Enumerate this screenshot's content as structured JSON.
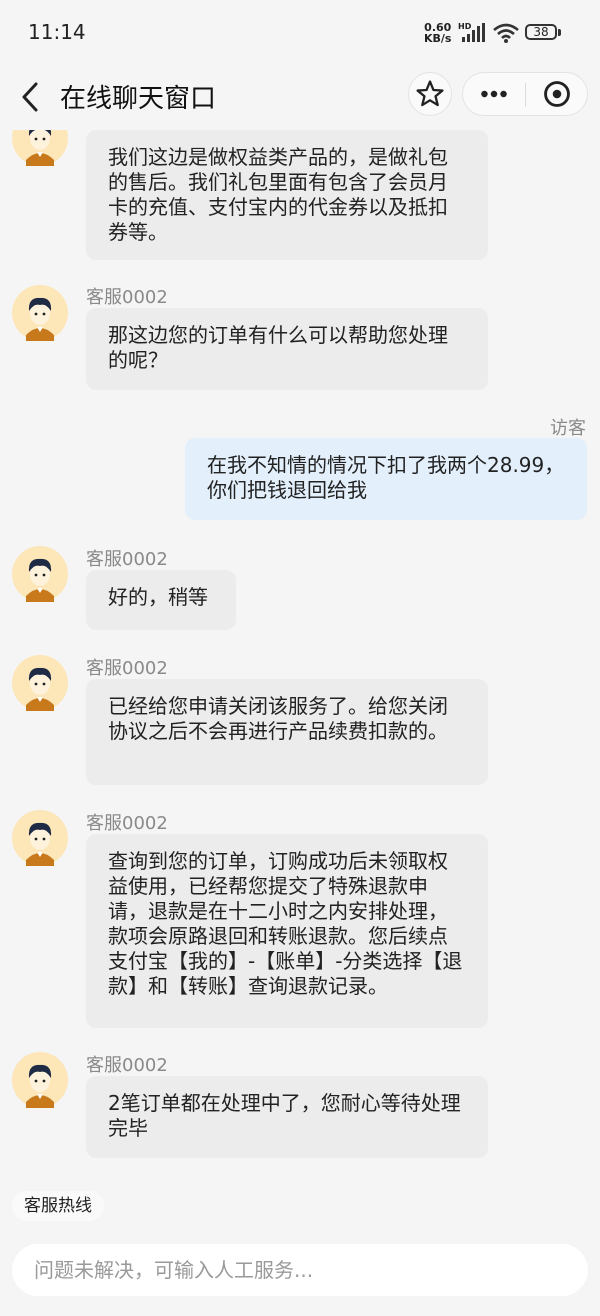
{
  "status_bar": {
    "time": "11:14",
    "net_speed": "0.60",
    "net_unit": "KB/s",
    "hd_label": "HD",
    "battery": "38"
  },
  "nav": {
    "title": "在线聊天窗口",
    "icons": [
      "chevron-left-icon",
      "star-icon",
      "more-icon",
      "target-icon"
    ]
  },
  "messages": [
    {
      "sender": "",
      "role": "agent",
      "text": "我们这边是做权益类产品的，是做礼包的售后。我们礼包里面有包含了会员月卡的充值、支付宝内的代金券以及抵扣券等。"
    },
    {
      "sender": "客服0002",
      "role": "agent",
      "text": "那这边您的订单有什么可以帮助您处理的呢？"
    },
    {
      "sender": "访客",
      "role": "user",
      "text": "在我不知情的情况下扣了我两个28.99，你们把钱退回给我"
    },
    {
      "sender": "客服0002",
      "role": "agent",
      "text": "好的，稍等"
    },
    {
      "sender": "客服0002",
      "role": "agent",
      "text": "已经给您申请关闭该服务了。给您关闭协议之后不会再进行产品续费扣款的。"
    },
    {
      "sender": "客服0002",
      "role": "agent",
      "text": "查询到您的订单，订购成功后未领取权益使用，已经帮您提交了特殊退款申请，退款是在十二小时之内安排处理，款项会原路退回和转账退款。您后续点支付宝【我的】-【账单】-分类选择【退款】和【转账】查询退款记录。"
    },
    {
      "sender": "客服0002",
      "role": "agent",
      "text": "2笔订单都在处理中了，您耐心等待处理完毕"
    }
  ],
  "bottom": {
    "hotline_label": "客服热线",
    "input_placeholder": "问题未解决，可输入人工服务..."
  },
  "colors": {
    "background": "#f5f5f5",
    "agent_bubble": "#ececec",
    "user_bubble": "#e3effb",
    "avatar_bg": "#fde6b8",
    "avatar_shirt": "#c8791c"
  }
}
